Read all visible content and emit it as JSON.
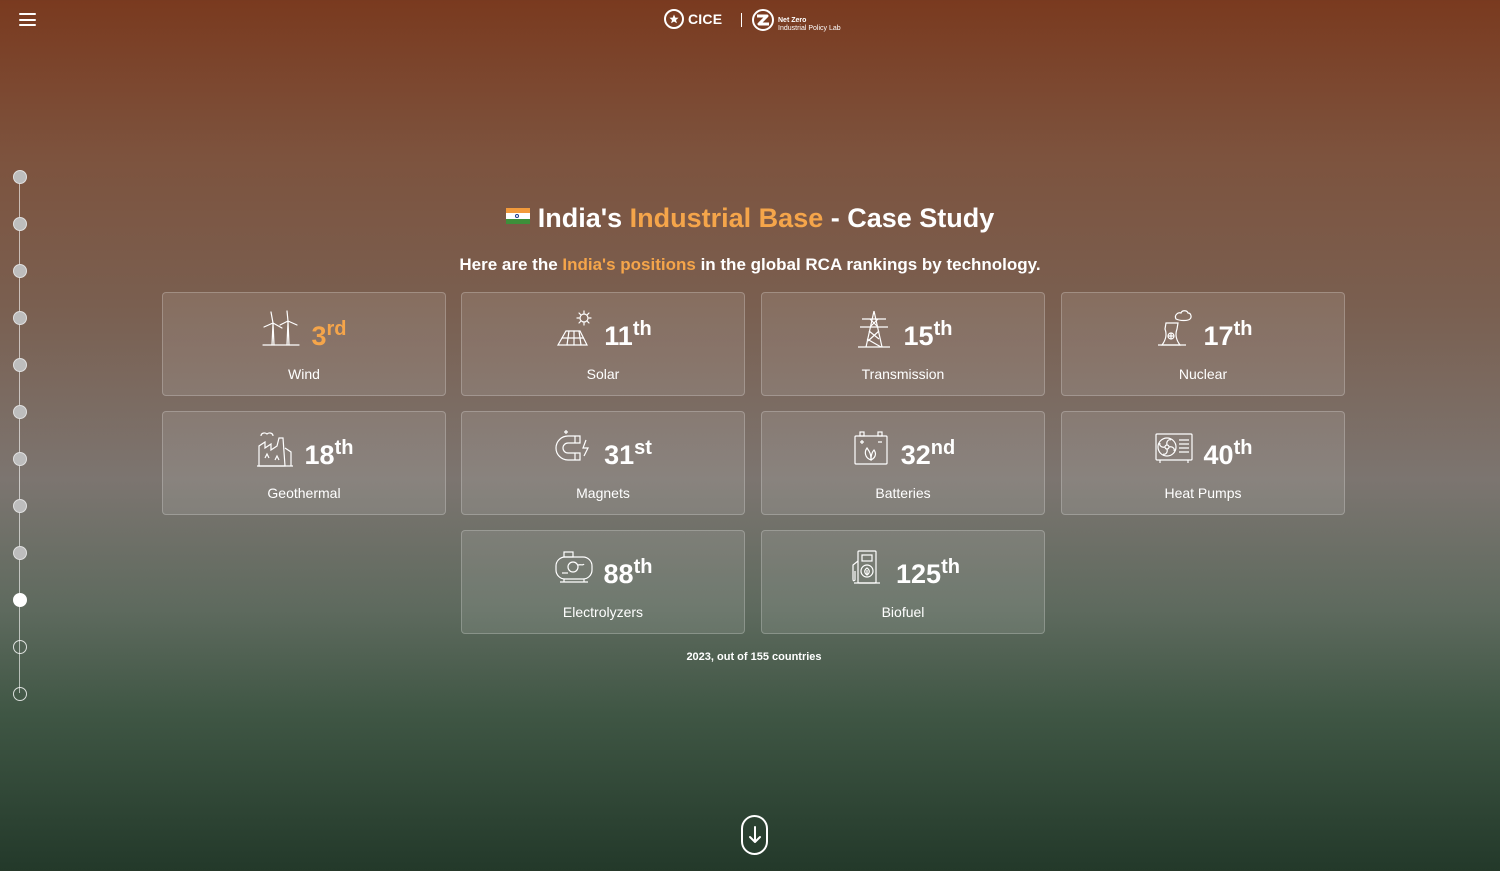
{
  "header": {
    "menu_icon": "hamburger-menu-icon",
    "logo_cice": "CICE",
    "logo_netzero_line1": "Net Zero",
    "logo_netzero_line2": "Industrial Policy Lab"
  },
  "progress": {
    "total_steps": 12,
    "active_step": 10
  },
  "title": {
    "flag_icon": "india-flag-icon",
    "prefix": "India's ",
    "highlight": "Industrial Base",
    "suffix": " - Case Study"
  },
  "subtitle": {
    "prefix": "Here are the ",
    "highlight": "India's positions",
    "suffix": " in the global RCA rankings by technology."
  },
  "cards": [
    {
      "rank": "3",
      "suffix": "rd",
      "label": "Wind",
      "icon": "wind-turbine-icon"
    },
    {
      "rank": "11",
      "suffix": "th",
      "label": "Solar",
      "icon": "solar-panel-icon"
    },
    {
      "rank": "15",
      "suffix": "th",
      "label": "Transmission",
      "icon": "transmission-tower-icon"
    },
    {
      "rank": "17",
      "suffix": "th",
      "label": "Nuclear",
      "icon": "nuclear-plant-icon"
    },
    {
      "rank": "18",
      "suffix": "th",
      "label": "Geothermal",
      "icon": "geothermal-plant-icon"
    },
    {
      "rank": "31",
      "suffix": "st",
      "label": "Magnets",
      "icon": "magnet-icon"
    },
    {
      "rank": "32",
      "suffix": "nd",
      "label": "Batteries",
      "icon": "battery-icon"
    },
    {
      "rank": "40",
      "suffix": "th",
      "label": "Heat Pumps",
      "icon": "heat-pump-icon"
    },
    {
      "rank": "88",
      "suffix": "th",
      "label": "Electrolyzers",
      "icon": "electrolyzer-icon"
    },
    {
      "rank": "125",
      "suffix": "th",
      "label": "Biofuel",
      "icon": "biofuel-pump-icon"
    }
  ],
  "footnote": "2023, out of 155 countries",
  "scroll_icon": "arrow-down-icon",
  "colors": {
    "accent": "#f5a54a",
    "text": "#ffffff"
  }
}
